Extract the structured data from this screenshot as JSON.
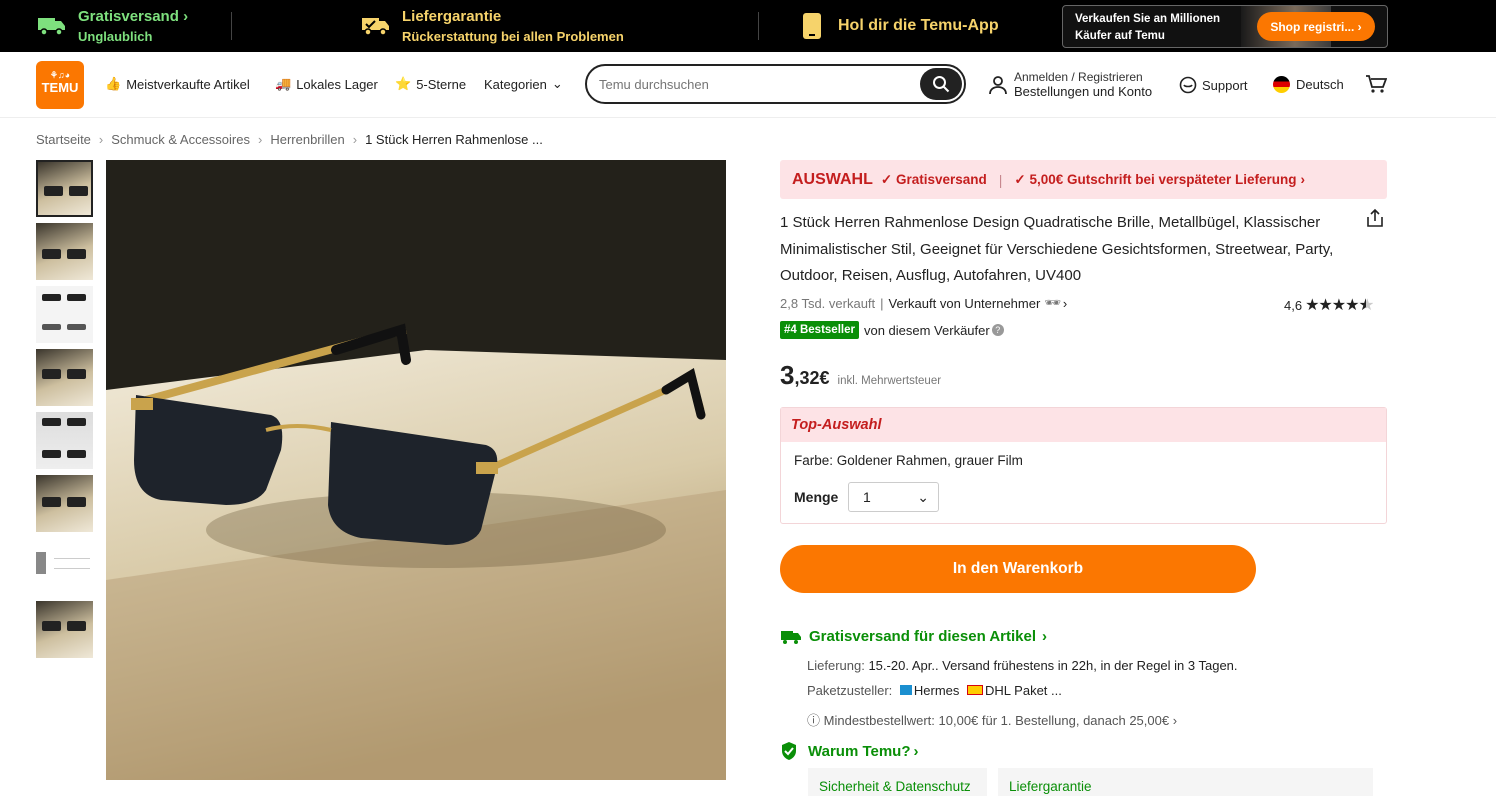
{
  "promo": {
    "free_shipping_title": "Gratisversand",
    "free_shipping_sub": "Unglaublich",
    "delivery_title": "Liefergarantie",
    "delivery_sub": "Rückerstattung bei allen Problemen",
    "app_label": "Hol dir die Temu-App",
    "sell_line1": "Verkaufen Sie an Millionen",
    "sell_line2": "Käufer auf Temu",
    "sell_button": "Shop registri..."
  },
  "header": {
    "logo_text": "TEMU",
    "nav": [
      "Meistverkaufte Artikel",
      "Lokales Lager",
      "5-Sterne",
      "Kategorien"
    ],
    "search_placeholder": "Temu durchsuchen",
    "account_line1": "Anmelden / Registrieren",
    "account_line2": "Bestellungen und Konto",
    "support": "Support",
    "language": "Deutsch"
  },
  "breadcrumb": [
    "Startseite",
    "Schmuck & Accessoires",
    "Herrenbrillen",
    "1 Stück Herren Rahmenlose ..."
  ],
  "product": {
    "banner_label": "AUSWAHL",
    "banner_item1": "Gratisversand",
    "banner_item2": "5,00€ Gutschrift bei verspäteter Lieferung",
    "title": "1 Stück Herren Rahmenlose Design Quadratische Brille, Metallbügel, Klassischer Minimalistischer Stil, Geeignet für Verschiedene Gesichtsformen, Streetwear, Party, Outdoor, Reisen, Ausflug, Autofahren, UV400",
    "sold": "2,8 Tsd. verkauft",
    "seller": "Verkauft von Unternehmer",
    "rating": "4,6",
    "rating_value": 4.6,
    "bestseller_tag": "#4 Bestseller",
    "bestseller_text": "von diesem Verkäufer",
    "price_int": "3",
    "price_dec": ",32€",
    "vat": "inkl. Mehrwertsteuer",
    "top_choice": "Top-Auswahl",
    "color_option": "Farbe: Goldener Rahmen, grauer Film",
    "quantity_label": "Menge",
    "quantity_value": "1",
    "cart_button": "In den Warenkorb"
  },
  "shipping": {
    "title": "Gratisversand für diesen Artikel",
    "delivery_label": "Lieferung:",
    "delivery_value": "15.-20. Apr.. Versand frühestens in 22h, in der Regel in 3 Tagen.",
    "carrier_label": "Paketzusteller:",
    "carrier1": "Hermes",
    "carrier2": "DHL Paket ...",
    "min_order": "Mindestbestellwert: 10,00€ für 1. Bestellung, danach 25,00€"
  },
  "why": {
    "title": "Warum Temu?",
    "tab1": "Sicherheit & Datenschutz",
    "tab2": "Liefergarantie"
  },
  "colors": {
    "accent": "#fb7701",
    "green": "#0a8f08",
    "red": "#c41e1e",
    "pink": "#fde3e6"
  }
}
